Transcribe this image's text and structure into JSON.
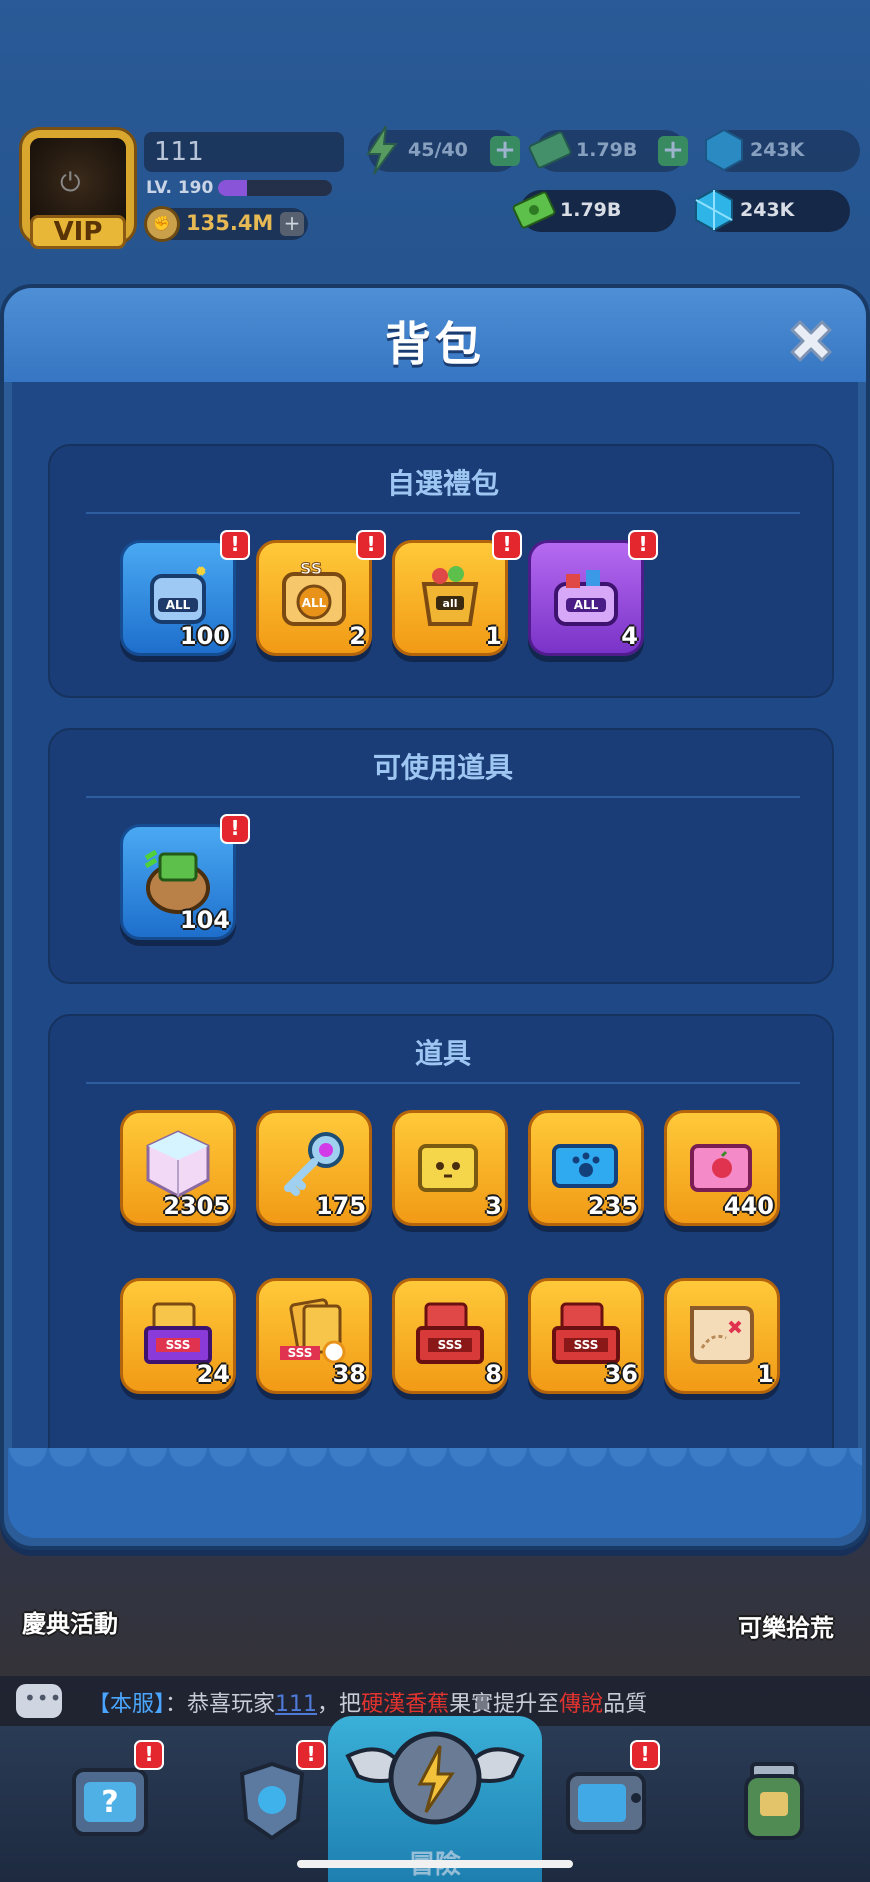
{
  "hud": {
    "vip_label": "VIP",
    "player_name": "111",
    "level_label": "LV. 190",
    "level_progress": 0.25,
    "power": "135.4M",
    "power_plus": "+",
    "energy_faded": "45/40",
    "cash_faded": "1.79B",
    "gems_faded": "243K",
    "cash": "1.79B",
    "gems": "243K",
    "plus": "+"
  },
  "backpack": {
    "title": "背包",
    "close_icon": "close-icon",
    "sections": [
      {
        "title": "自選禮包",
        "items": [
          {
            "name": "all-gear-chest",
            "qty": "100",
            "style": "blue",
            "alert": "!"
          },
          {
            "name": "ss-all-chest",
            "qty": "2",
            "style": "gold",
            "alert": "!"
          },
          {
            "name": "all-bag",
            "qty": "1",
            "style": "gold",
            "alert": "!"
          },
          {
            "name": "all-purple-chest",
            "qty": "4",
            "style": "purple",
            "alert": "!"
          }
        ]
      },
      {
        "title": "可使用道具",
        "items": [
          {
            "name": "money-bag",
            "qty": "104",
            "style": "blue",
            "alert": "!"
          }
        ]
      },
      {
        "title": "道具",
        "items": [
          {
            "name": "rainbow-cube",
            "qty": "2305",
            "style": "gold"
          },
          {
            "name": "gem-key",
            "qty": "175",
            "style": "gold"
          },
          {
            "name": "yellow-ticket",
            "qty": "3",
            "style": "gold"
          },
          {
            "name": "paw-ticket",
            "qty": "235",
            "style": "gold"
          },
          {
            "name": "pink-ticket",
            "qty": "440",
            "style": "gold"
          },
          {
            "name": "sss-purple-envelope",
            "qty": "24",
            "style": "gold"
          },
          {
            "name": "sss-gold-cards",
            "qty": "38",
            "style": "gold"
          },
          {
            "name": "sss-red-envelope",
            "qty": "8",
            "style": "gold"
          },
          {
            "name": "sss-red-envelope-2",
            "qty": "36",
            "style": "gold"
          },
          {
            "name": "treasure-map",
            "qty": "1",
            "style": "gold"
          }
        ]
      }
    ]
  },
  "events": {
    "left": "慶典活動",
    "right": "可樂拾荒"
  },
  "chat": {
    "server_tag": "【本服】",
    "sep": "：",
    "prefix": "恭喜玩家",
    "player": "111",
    "middle": "，把",
    "item": "硬漢香蕉",
    "middle2": "果實提升至",
    "quality": "傳說",
    "suffix": "品質"
  },
  "nav": {
    "center_label": "冒險",
    "alert": "!"
  },
  "colors": {
    "gold_tile": "#f7b027",
    "blue_tile": "#2f86dd",
    "purple_tile": "#9a4ee0",
    "alert_red": "#e4272f",
    "cash_green": "#47b43a"
  }
}
